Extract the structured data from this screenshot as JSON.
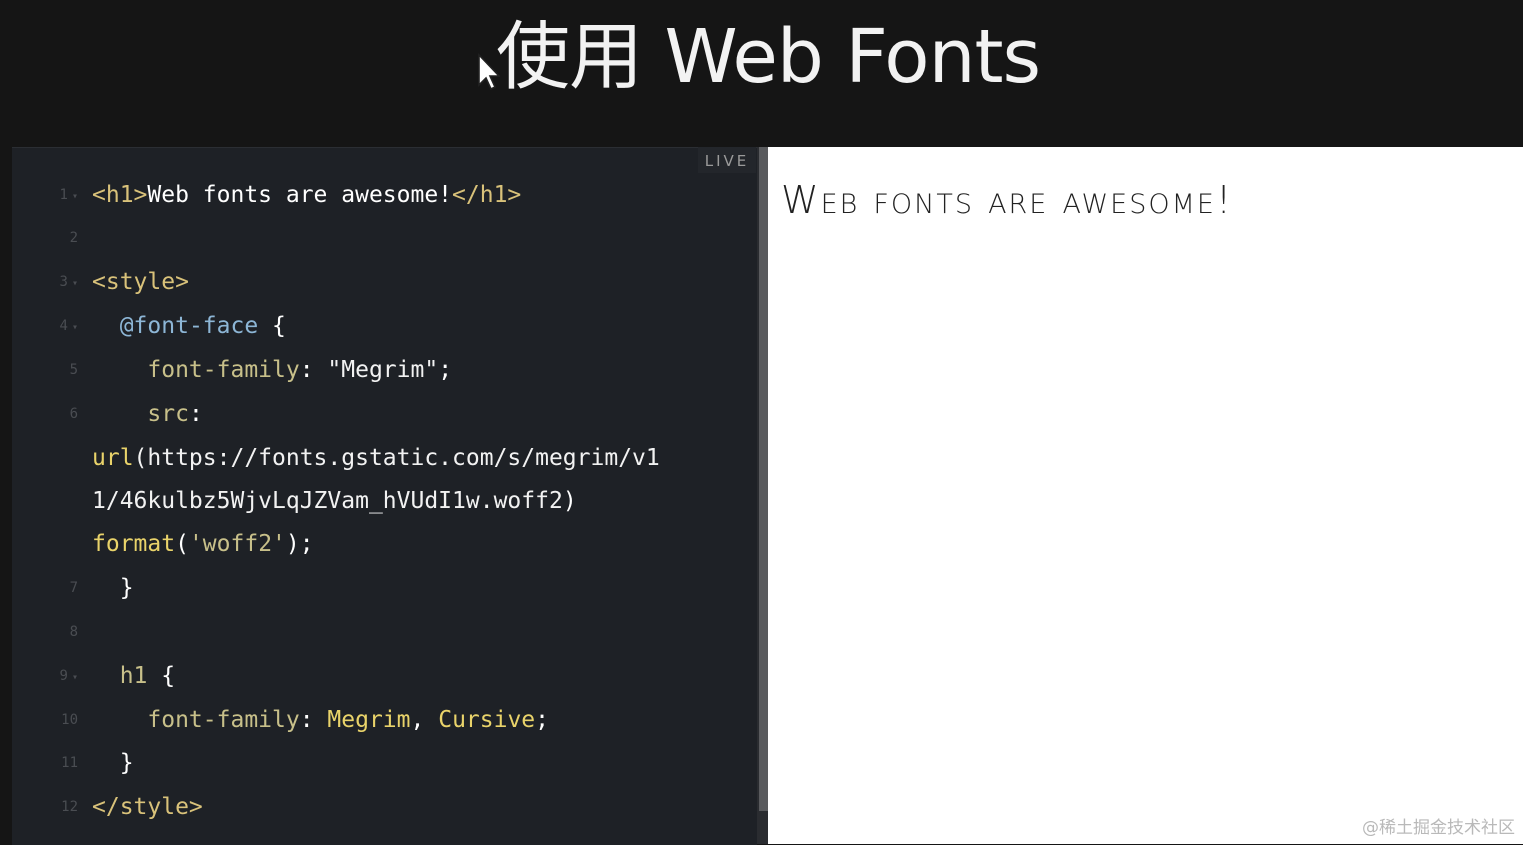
{
  "title": "使用 Web Fonts",
  "live_label": "LIVE",
  "code_lines": [
    {
      "n": "1",
      "parts": [
        "<h1>",
        "Web fonts are awesome!",
        "</h1>"
      ]
    },
    {
      "n": "2"
    },
    {
      "n": "3",
      "parts": [
        "<style>"
      ]
    },
    {
      "n": "4",
      "parts": [
        "@font-face",
        " {"
      ]
    },
    {
      "n": "5",
      "parts": [
        "font-family",
        ": ",
        "\"Megrim\"",
        ";"
      ]
    },
    {
      "n": "6",
      "parts": [
        "src",
        ":"
      ]
    },
    {
      "parts": [
        "url",
        "(https://fonts.gstatic.com/s/megrim/v1"
      ]
    },
    {
      "parts": [
        "1/46kulbz5WjvLqJZVam_hVUdI1w.woff2",
        ")"
      ]
    },
    {
      "parts": [
        "format",
        "(",
        "'woff2'",
        ");"
      ]
    },
    {
      "n": "7",
      "parts": [
        "}"
      ]
    },
    {
      "n": "8"
    },
    {
      "n": "9",
      "parts": [
        "h1",
        " {"
      ]
    },
    {
      "n": "10",
      "parts": [
        "font-family",
        ": ",
        "Megrim",
        ", ",
        "Cursive",
        ";"
      ]
    },
    {
      "n": "11",
      "parts": [
        "}"
      ]
    },
    {
      "n": "12",
      "parts": [
        "</style>"
      ]
    }
  ],
  "preview": {
    "h1": "Web fonts are awesome!"
  },
  "watermark": "@稀土掘金技术社区",
  "colors": {
    "background": "#151515",
    "editor_bg": "#1e2126",
    "tag": "#d9c27a",
    "property": "#c8c08a",
    "atrule": "#8db6d6",
    "keyword": "#e9d36a",
    "preview_bg": "#ffffff"
  }
}
